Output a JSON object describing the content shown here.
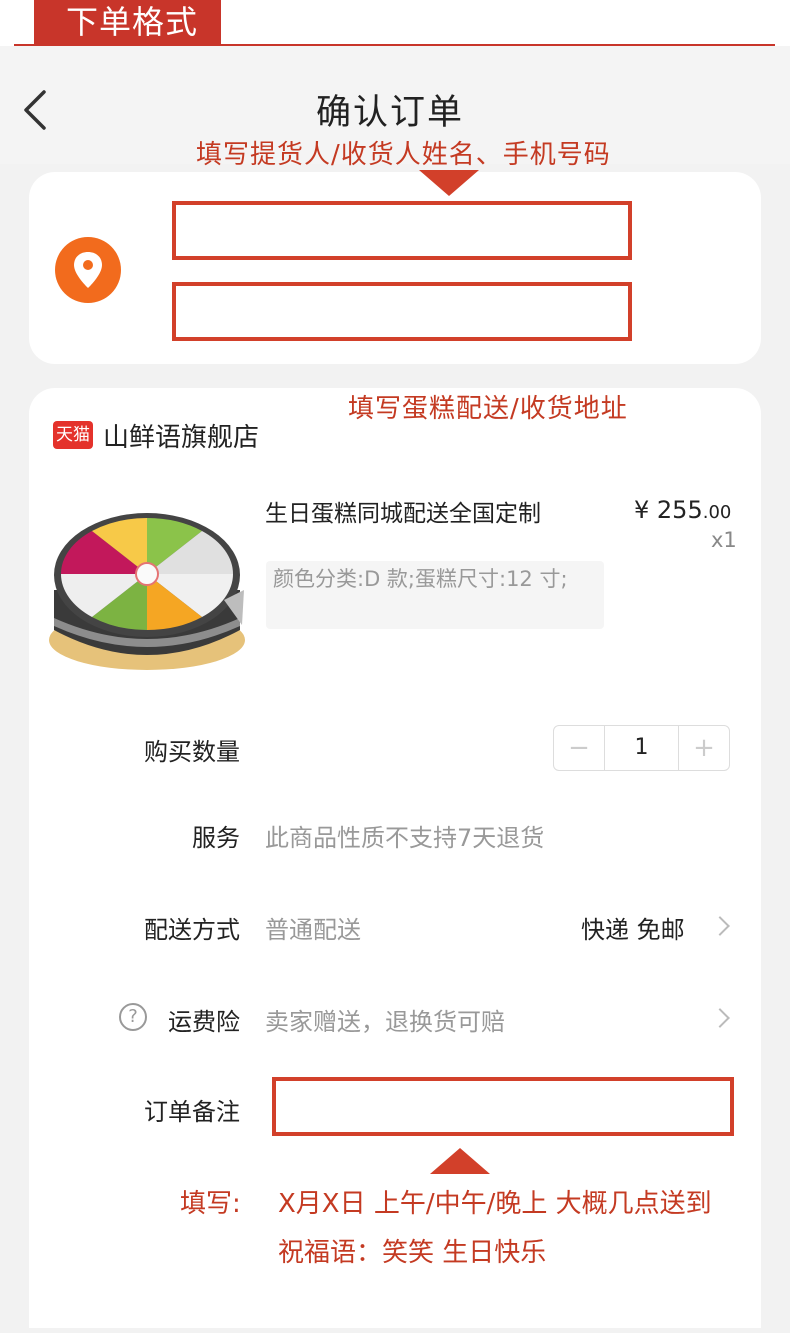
{
  "banner": {
    "tag": "下单格式"
  },
  "header": {
    "title": "确认订单"
  },
  "annotations": {
    "contact_note": "填写提货人/收货人姓名、手机号码",
    "address_note": "填写蛋糕配送/收货地址",
    "fill_prefix": "填写:",
    "fill_time": "X月X日  上午/中午/晚上  大概几点送到",
    "fill_blessing": "祝福语：笑笑 生日快乐"
  },
  "store": {
    "badge": "天猫",
    "name": "山鲜语旗舰店"
  },
  "product": {
    "title": "生日蛋糕同城配送全国定制",
    "price_symbol": "¥ ",
    "price_int": "255",
    "price_dec": ".00",
    "quantity": "x1",
    "sku": "颜色分类:D 款;蛋糕尺寸:12 寸;"
  },
  "rows": {
    "quantity_label": "购买数量",
    "quantity_minus": "−",
    "quantity_value": "1",
    "quantity_plus": "+",
    "service_label": "服务",
    "service_value": "此商品性质不支持7天退货",
    "delivery_label": "配送方式",
    "delivery_value": "普通配送",
    "delivery_right": "快递 免邮",
    "insurance_label": "运费险",
    "insurance_value": "卖家赠送，退换货可赔",
    "remark_label": "订单备注"
  },
  "icons": {
    "back": "back-icon",
    "location": "location-pin-icon",
    "help": "question-circle-icon",
    "chevron": "chevron-right-icon"
  },
  "colors": {
    "accent_red": "#c8352a",
    "location_orange": "#f26b1d",
    "tmall_red": "#e4322b"
  }
}
